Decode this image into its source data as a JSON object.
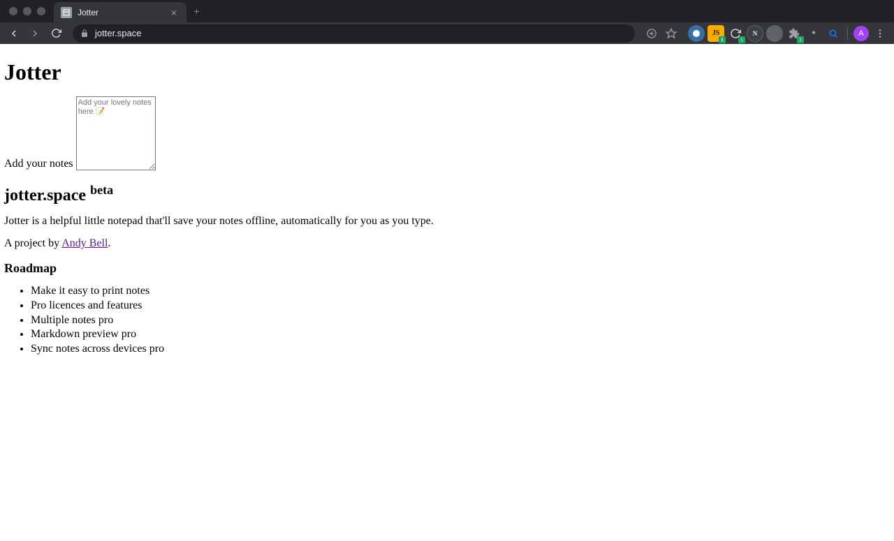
{
  "browser": {
    "tab": {
      "title": "Jotter"
    },
    "url": "jotter.space",
    "avatar_initial": "A"
  },
  "page": {
    "heading": "Jotter",
    "notes_label": "Add your notes",
    "textarea_placeholder": "Add your lovely notes here 📝",
    "site_title": "jotter.space ",
    "site_title_badge": "beta",
    "description": "Jotter is a helpful little notepad that'll save your notes offline, automatically for you as you type.",
    "byline_prefix": "A project by ",
    "byline_link_text": "Andy Bell",
    "byline_suffix": ".",
    "roadmap_heading": "Roadmap",
    "roadmap_items": [
      "Make it easy to print notes",
      "Pro licences and features",
      "Multiple notes pro",
      "Markdown preview pro",
      "Sync notes across devices pro"
    ]
  }
}
